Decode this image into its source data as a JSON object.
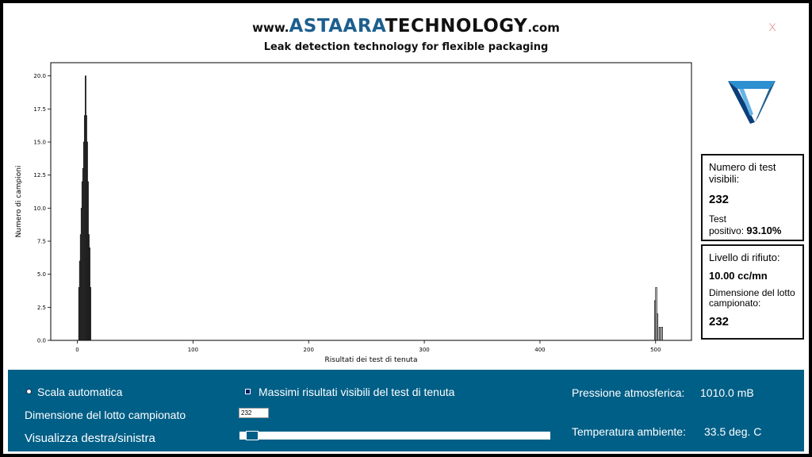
{
  "header": {
    "brand_prefix": "www.",
    "brand_name_a": "ASTAARA",
    "brand_name_b": "TECHNOLOGY",
    "brand_suffix": ".com",
    "tagline": "Leak detection technology for flexible packaging",
    "close_label": "X"
  },
  "icons": {
    "logo": "triangle-logo-icon",
    "close": "close-icon"
  },
  "colors": {
    "brand_blue": "#1d5f8e",
    "panel_blue": "#005f87",
    "logo_light": "#2c8fd0",
    "logo_dark": "#0b3f7a",
    "bar_gray": "#808080"
  },
  "stats": {
    "visible_tests_label": "Numero di test visibili:",
    "visible_tests_value": "232",
    "positive_label_1": "Test",
    "positive_label_2": "positivo:",
    "positive_value": "93.10%",
    "reject_label": "Livello di rifiuto:",
    "reject_value": "10.00 cc/mn",
    "lot_label": "Dimensione del lotto campionato:",
    "lot_value": "232"
  },
  "controls": {
    "auto_scale_label": "Scala automatica",
    "max_visible_label": "Massimi risultati visibili del test di tenuta",
    "lot_size_label": "Dimensione del lotto campionato",
    "lot_size_input": "232",
    "scroll_label": "Visualizza destra/sinistra",
    "scroll_position": 0.02,
    "pressure_label": "Pressione atmosferica:",
    "pressure_value": "1010.0 mB",
    "temp_label": "Temperatura ambiente:",
    "temp_value": "33.5 deg. C"
  },
  "chart_data": {
    "type": "bar",
    "xlabel": "Risultati dei test di tenuta",
    "ylabel": "Numero di campioni",
    "xlim": [
      -23,
      531
    ],
    "ylim": [
      0,
      21
    ],
    "xticks": [
      0,
      100,
      200,
      300,
      400,
      500
    ],
    "yticks": [
      "0.0",
      "2.5",
      "5.0",
      "7.5",
      "10.0",
      "12.5",
      "15.0",
      "17.5",
      "20.0"
    ],
    "grid": false,
    "series": [
      {
        "values": [
          {
            "x": 1.5,
            "y": 4
          },
          {
            "x": 2.2,
            "y": 6
          },
          {
            "x": 2.9,
            "y": 8
          },
          {
            "x": 3.6,
            "y": 10
          },
          {
            "x": 4.3,
            "y": 12
          },
          {
            "x": 5.0,
            "y": 13
          },
          {
            "x": 5.7,
            "y": 15
          },
          {
            "x": 6.4,
            "y": 17
          },
          {
            "x": 7.1,
            "y": 20
          },
          {
            "x": 7.8,
            "y": 17
          },
          {
            "x": 8.5,
            "y": 15
          },
          {
            "x": 9.2,
            "y": 12
          },
          {
            "x": 9.9,
            "y": 8
          },
          {
            "x": 10.6,
            "y": 7
          },
          {
            "x": 11.3,
            "y": 4
          }
        ]
      },
      {
        "values": [
          {
            "x": 499.5,
            "y": 3
          },
          {
            "x": 500.5,
            "y": 4
          },
          {
            "x": 501.5,
            "y": 2
          },
          {
            "x": 503.5,
            "y": 1
          },
          {
            "x": 505.5,
            "y": 1
          }
        ]
      }
    ]
  }
}
